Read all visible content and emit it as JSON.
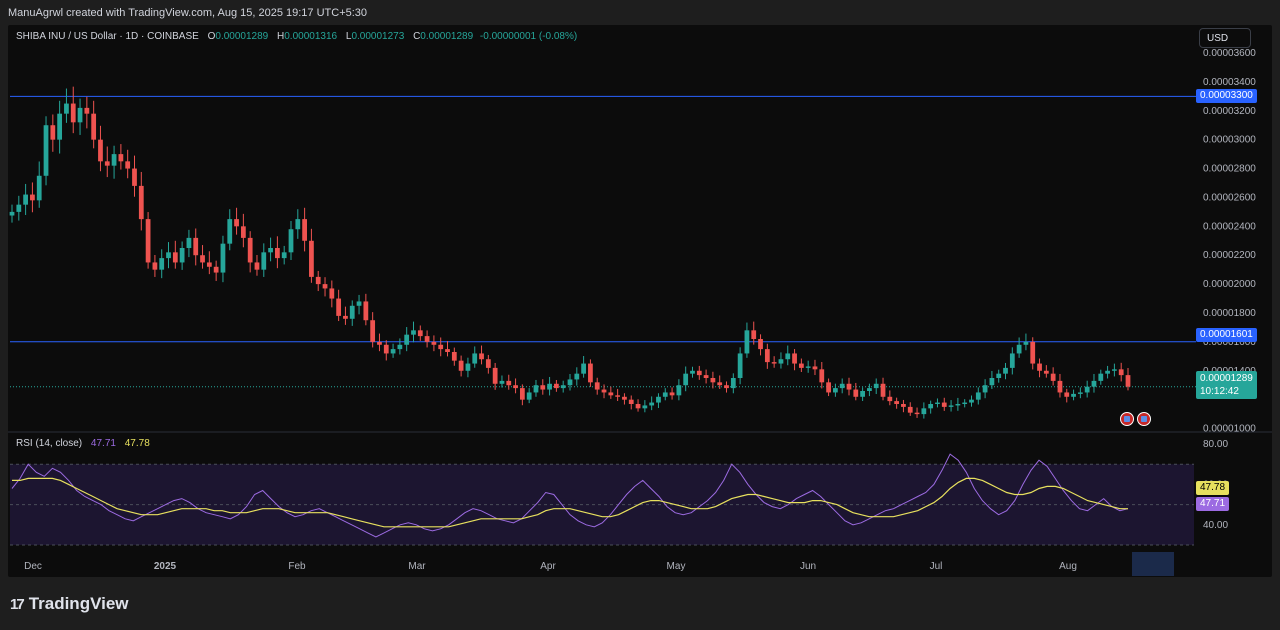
{
  "header": {
    "attribution": "ManuAgrwl created with TradingView.com, Aug 15, 2025 19:17 UTC+5:30"
  },
  "symbol": {
    "title": "SHIBA INU / US Dollar · 1D · COINBASE",
    "open_label": "O",
    "open": "0.00001289",
    "high_label": "H",
    "high": "0.00001316",
    "low_label": "L",
    "low": "0.00001273",
    "close_label": "C",
    "close": "0.00001289",
    "change": "-0.00000001 (-0.08%)"
  },
  "currency_button": "USD",
  "price_axis": {
    "ticks": [
      "0.00003600",
      "0.00003400",
      "0.00003200",
      "0.00003000",
      "0.00002800",
      "0.00002600",
      "0.00002400",
      "0.00002200",
      "0.00002000",
      "0.00001800",
      "0.00001600",
      "0.00001400",
      "0.00001000"
    ],
    "resistance_label": "0.00003300",
    "support_label": "0.00001601",
    "last_price_label": "0.00001289",
    "countdown": "10:12:42"
  },
  "rsi": {
    "name": "RSI (14, close)",
    "value": "47.71",
    "ma_value": "47.78",
    "ticks": [
      "80.00",
      "60.00",
      "40.00"
    ]
  },
  "time_axis": [
    "Dec",
    "2025",
    "Feb",
    "Mar",
    "Apr",
    "May",
    "Jun",
    "Jul",
    "Aug"
  ],
  "logo_text": "TradingView",
  "colors": {
    "up": "#26a69a",
    "down": "#ef5350",
    "horizontal_line": "#2962ff",
    "rsi_line": "#9c6be2",
    "rsi_ma": "#e7e05e",
    "rsi_band": "#1c1530"
  },
  "chart_data": {
    "type": "candlestick",
    "price_scale": {
      "min": 9.9e-06,
      "max": 3.6e-05
    },
    "horizontal_lines": [
      3.3e-05,
      1.601e-05
    ],
    "last_price": 1.289e-05,
    "closes": [
      2.5e-05,
      2.55e-05,
      2.62e-05,
      2.58e-05,
      2.75e-05,
      3.1e-05,
      3e-05,
      3.18e-05,
      3.25e-05,
      3.12e-05,
      3.22e-05,
      3.18e-05,
      3e-05,
      2.85e-05,
      2.82e-05,
      2.9e-05,
      2.85e-05,
      2.8e-05,
      2.68e-05,
      2.45e-05,
      2.15e-05,
      2.1e-05,
      2.18e-05,
      2.22e-05,
      2.15e-05,
      2.25e-05,
      2.32e-05,
      2.2e-05,
      2.15e-05,
      2.12e-05,
      2.08e-05,
      2.28e-05,
      2.45e-05,
      2.4e-05,
      2.32e-05,
      2.15e-05,
      2.1e-05,
      2.22e-05,
      2.25e-05,
      2.18e-05,
      2.22e-05,
      2.38e-05,
      2.45e-05,
      2.3e-05,
      2.05e-05,
      2e-05,
      1.97e-05,
      1.9e-05,
      1.78e-05,
      1.76e-05,
      1.85e-05,
      1.88e-05,
      1.75e-05,
      1.6e-05,
      1.58e-05,
      1.52e-05,
      1.55e-05,
      1.58e-05,
      1.65e-05,
      1.68e-05,
      1.64e-05,
      1.6e-05,
      1.58e-05,
      1.55e-05,
      1.53e-05,
      1.47e-05,
      1.4e-05,
      1.45e-05,
      1.52e-05,
      1.48e-05,
      1.42e-05,
      1.31e-05,
      1.33e-05,
      1.3e-05,
      1.28e-05,
      1.2e-05,
      1.25e-05,
      1.3e-05,
      1.27e-05,
      1.31e-05,
      1.28e-05,
      1.3e-05,
      1.34e-05,
      1.38e-05,
      1.45e-05,
      1.32e-05,
      1.27e-05,
      1.25e-05,
      1.23e-05,
      1.22e-05,
      1.2e-05,
      1.17e-05,
      1.14e-05,
      1.16e-05,
      1.18e-05,
      1.22e-05,
      1.25e-05,
      1.23e-05,
      1.3e-05,
      1.38e-05,
      1.4e-05,
      1.37e-05,
      1.35e-05,
      1.32e-05,
      1.3e-05,
      1.28e-05,
      1.35e-05,
      1.52e-05,
      1.68e-05,
      1.62e-05,
      1.55e-05,
      1.46e-05,
      1.45e-05,
      1.48e-05,
      1.52e-05,
      1.45e-05,
      1.42e-05,
      1.43e-05,
      1.41e-05,
      1.32e-05,
      1.25e-05,
      1.28e-05,
      1.31e-05,
      1.27e-05,
      1.22e-05,
      1.26e-05,
      1.28e-05,
      1.31e-05,
      1.22e-05,
      1.19e-05,
      1.17e-05,
      1.15e-05,
      1.11e-05,
      1.1e-05,
      1.14e-05,
      1.17e-05,
      1.18e-05,
      1.15e-05,
      1.16e-05,
      1.17e-05,
      1.18e-05,
      1.2e-05,
      1.25e-05,
      1.3e-05,
      1.35e-05,
      1.38e-05,
      1.42e-05,
      1.52e-05,
      1.58e-05,
      1.6e-05,
      1.45e-05,
      1.4e-05,
      1.38e-05,
      1.33e-05,
      1.25e-05,
      1.22e-05,
      1.24e-05,
      1.25e-05,
      1.29e-05,
      1.33e-05,
      1.38e-05,
      1.4e-05,
      1.41e-05,
      1.37e-05,
      1.29e-05
    ],
    "rsi_values": [
      58,
      63,
      70,
      66,
      64,
      68,
      66,
      62,
      57,
      54,
      52,
      50,
      47,
      45,
      43,
      42,
      44,
      46,
      48,
      50,
      52,
      53,
      51,
      48,
      46,
      45,
      44,
      43,
      45,
      49,
      55,
      57,
      53,
      49,
      46,
      44,
      45,
      47,
      48,
      46,
      44,
      42,
      40,
      38,
      36,
      34,
      36,
      38,
      40,
      41,
      40,
      38,
      37,
      38,
      40,
      43,
      46,
      48,
      47,
      45,
      43,
      42,
      41,
      43,
      47,
      51,
      56,
      55,
      50,
      45,
      42,
      40,
      39,
      41,
      45,
      50,
      55,
      59,
      62,
      58,
      54,
      49,
      46,
      45,
      46,
      49,
      52,
      56,
      62,
      70,
      66,
      60,
      55,
      51,
      49,
      48,
      50,
      53,
      55,
      57,
      54,
      50,
      46,
      42,
      40,
      41,
      43,
      45,
      47,
      48,
      50,
      52,
      54,
      56,
      60,
      67,
      75,
      72,
      66,
      58,
      52,
      48,
      45,
      47,
      52,
      60,
      67,
      72,
      69,
      63,
      57,
      52,
      48,
      47,
      50,
      53,
      49,
      47,
      48
    ],
    "rsi_ma_values": [
      62,
      62,
      63,
      63,
      63,
      63,
      62,
      60,
      58,
      56,
      54,
      52,
      50,
      48,
      47,
      46,
      45,
      45,
      45,
      46,
      47,
      48,
      48,
      48,
      48,
      47,
      47,
      46,
      46,
      46,
      47,
      48,
      48,
      48,
      47,
      46,
      46,
      46,
      46,
      46,
      45,
      44,
      43,
      42,
      41,
      40,
      39,
      39,
      39,
      39,
      39,
      39,
      39,
      39,
      39,
      40,
      41,
      42,
      43,
      43,
      43,
      43,
      43,
      43,
      44,
      45,
      47,
      48,
      48,
      48,
      47,
      46,
      45,
      44,
      44,
      45,
      47,
      49,
      51,
      52,
      52,
      51,
      50,
      49,
      48,
      48,
      48,
      49,
      51,
      53,
      54,
      55,
      55,
      54,
      53,
      52,
      51,
      51,
      51,
      52,
      52,
      51,
      50,
      48,
      46,
      45,
      44,
      44,
      44,
      44,
      45,
      46,
      47,
      49,
      51,
      54,
      58,
      61,
      63,
      63,
      62,
      60,
      58,
      56,
      55,
      55,
      56,
      58,
      59,
      59,
      58,
      56,
      54,
      52,
      51,
      50,
      49,
      48,
      48
    ]
  }
}
